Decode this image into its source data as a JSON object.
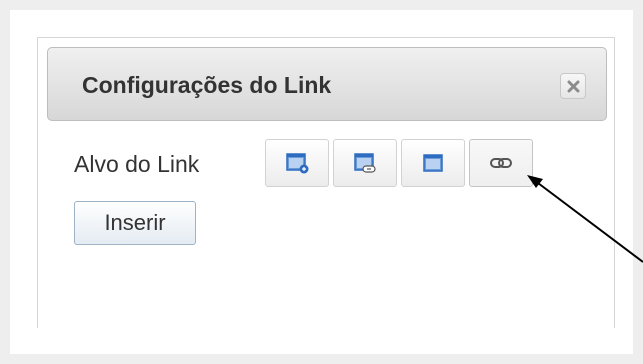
{
  "dialog": {
    "title": "Configurações do Link",
    "close_icon": "close-icon"
  },
  "link_target": {
    "label": "Alvo do Link",
    "options": [
      {
        "name": "target-new-window-icon",
        "selected": false
      },
      {
        "name": "target-link-window-icon",
        "selected": false
      },
      {
        "name": "target-same-window-icon",
        "selected": false
      },
      {
        "name": "chain-link-icon",
        "selected": true
      }
    ]
  },
  "actions": {
    "insert_label": "Inserir"
  },
  "colors": {
    "header_gradient_top": "#f0f0f0",
    "header_gradient_bottom": "#d7d7d7",
    "icon_blue": "#2e6cc1",
    "text": "#333333"
  }
}
